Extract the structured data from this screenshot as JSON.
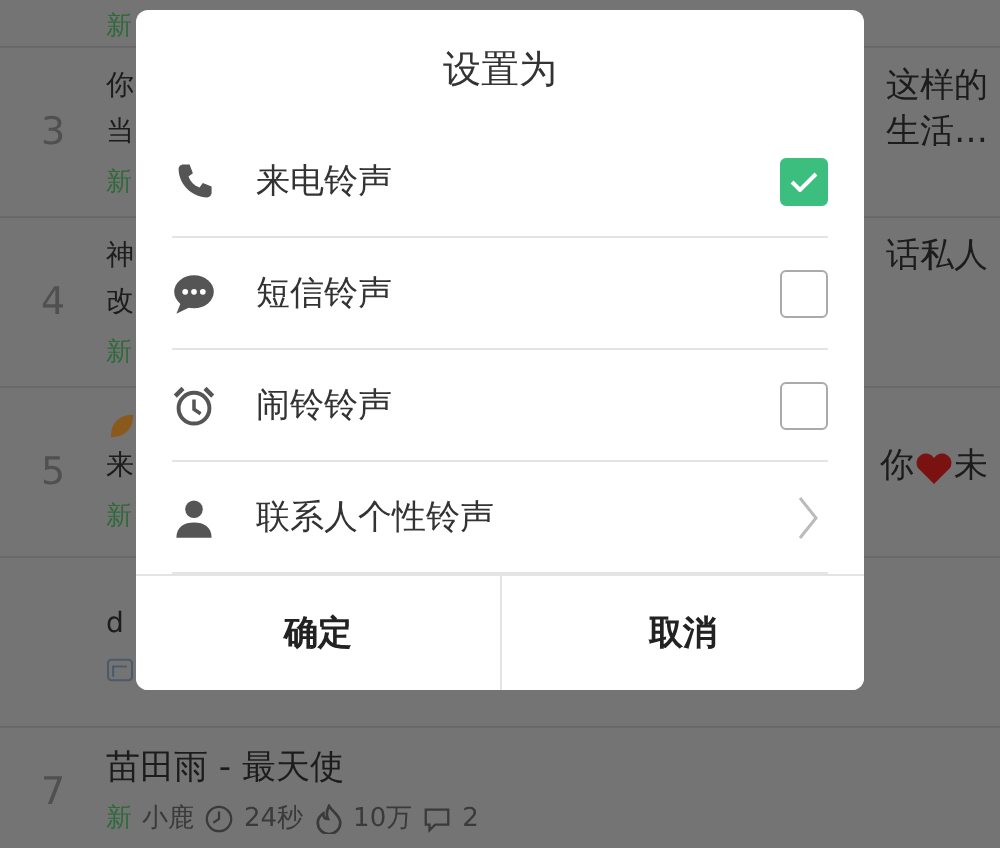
{
  "list": [
    {
      "tag": "新"
    },
    {
      "rank": "3",
      "lines": [
        {
          "left": "你",
          "right": [
            {
              "kind": "text",
              "text": "这样的"
            }
          ]
        },
        {
          "left": "当",
          "right": [
            {
              "kind": "text",
              "text": "生活…"
            }
          ]
        }
      ],
      "tag": "新"
    },
    {
      "rank": "4",
      "lines": [
        {
          "left": "神",
          "right": [
            {
              "kind": "text",
              "text": "话私人"
            }
          ]
        },
        {
          "left": "改"
        }
      ],
      "tag": "新"
    },
    {
      "rank": "5",
      "leaf": true,
      "lines": [
        {
          "left": "来",
          "right": [
            {
              "kind": "text",
              "text": "你"
            },
            {
              "kind": "heart"
            },
            {
              "kind": "text",
              "text": "未"
            }
          ]
        }
      ],
      "tag": "新"
    },
    {
      "lines": [
        {
          "left": "d"
        }
      ],
      "ad": true
    },
    {
      "rank": "7",
      "lines": [
        {
          "left": "苗田雨 - 最天使"
        }
      ],
      "meta": [
        {
          "kind": "tag",
          "text": "新"
        },
        {
          "kind": "text",
          "text": "小鹿"
        },
        {
          "kind": "clock",
          "text": "24秒"
        },
        {
          "kind": "fire",
          "text": "10万"
        },
        {
          "kind": "comment",
          "text": "2"
        }
      ]
    }
  ],
  "dialog": {
    "title": "设置为",
    "options": [
      {
        "kind": "check",
        "label": "来电铃声",
        "checked": true
      },
      {
        "kind": "check",
        "label": "短信铃声",
        "checked": false
      },
      {
        "kind": "check",
        "label": "闹铃铃声",
        "checked": false
      },
      {
        "kind": "link",
        "label": "联系人个性铃声"
      }
    ],
    "buttons": [
      "确定",
      "取消"
    ]
  }
}
